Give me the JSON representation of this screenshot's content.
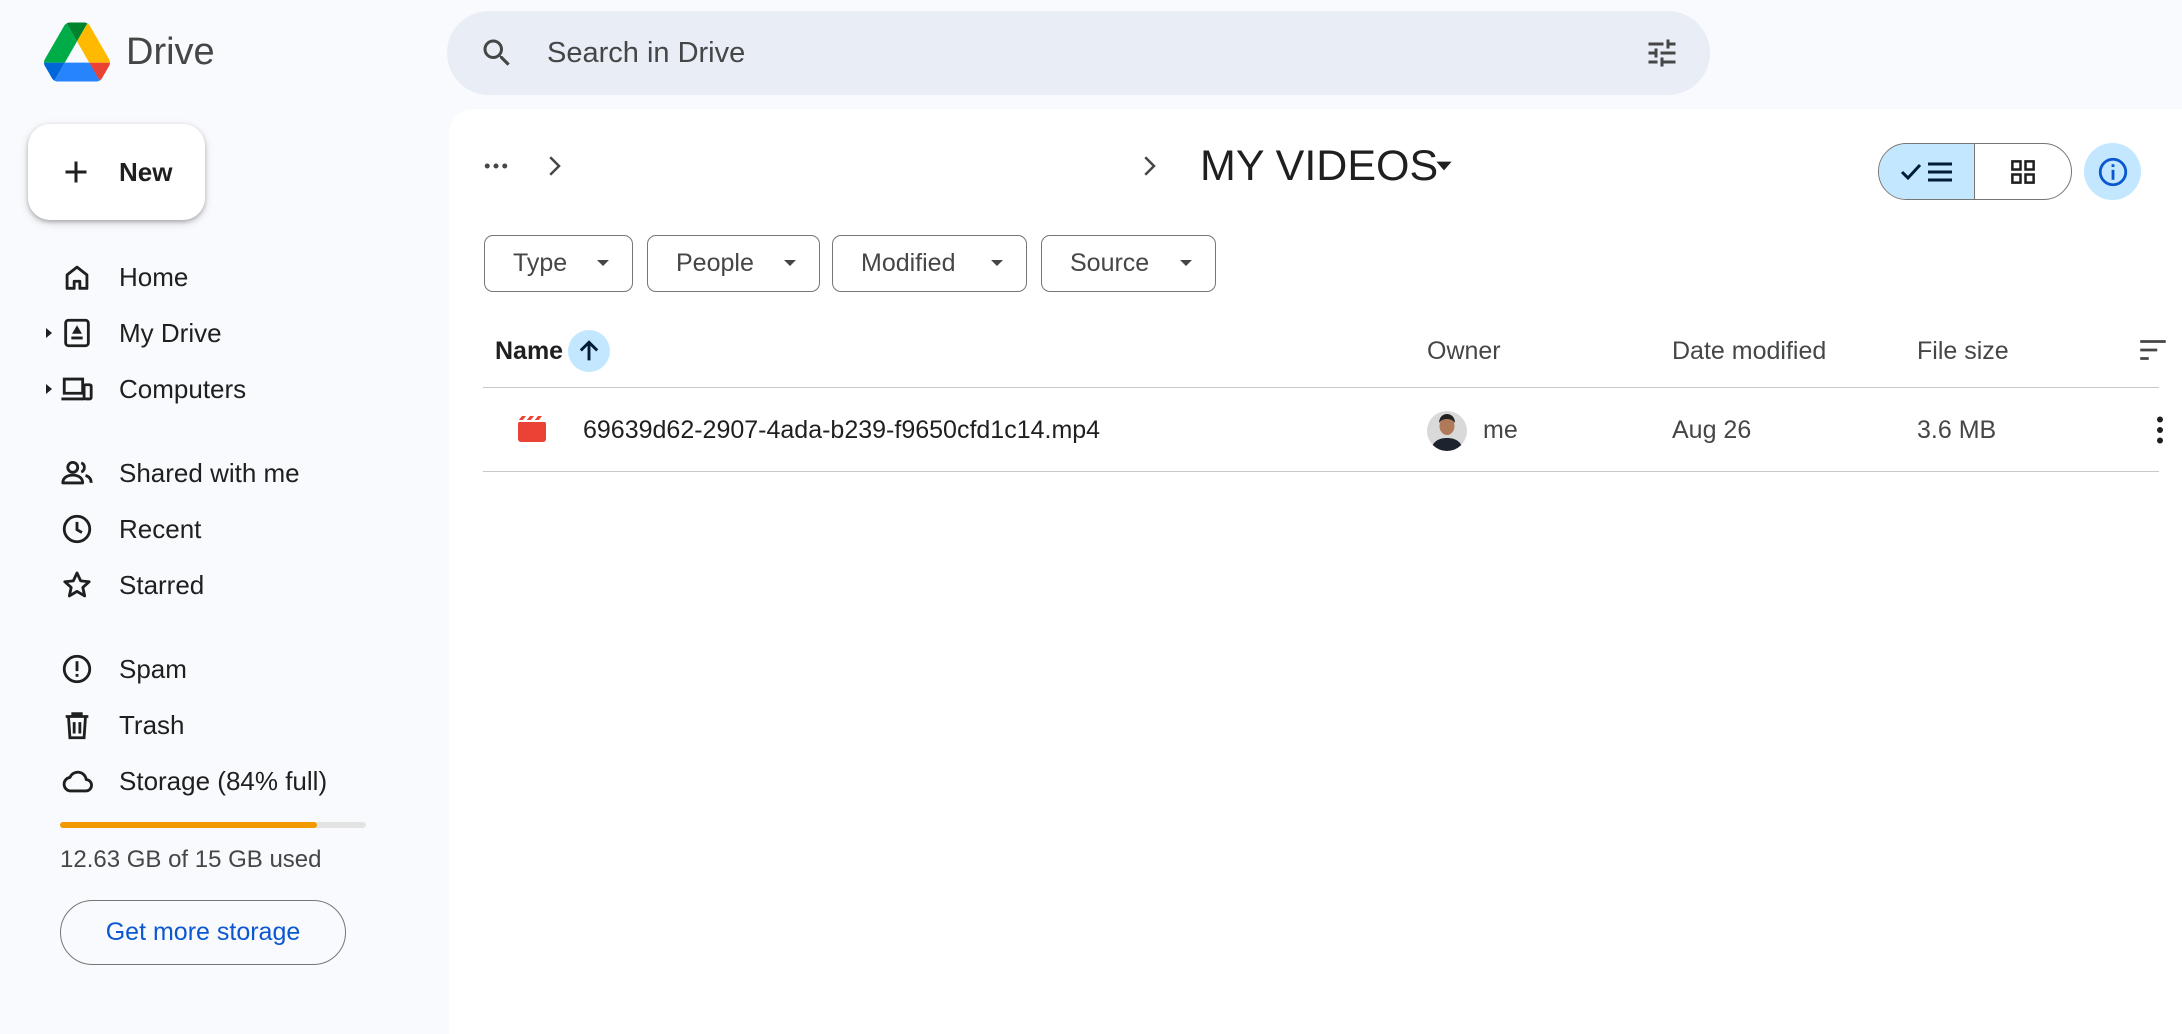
{
  "app": {
    "name": "Drive"
  },
  "search": {
    "placeholder": "Search in Drive"
  },
  "sidebar": {
    "new_label": "New",
    "items": [
      {
        "label": "Home",
        "icon": "home-icon"
      },
      {
        "label": "My Drive",
        "icon": "my-drive-icon",
        "expandable": true
      },
      {
        "label": "Computers",
        "icon": "computers-icon",
        "expandable": true
      },
      {
        "label": "Shared with me",
        "icon": "shared-icon"
      },
      {
        "label": "Recent",
        "icon": "clock-icon"
      },
      {
        "label": "Starred",
        "icon": "star-icon"
      },
      {
        "label": "Spam",
        "icon": "spam-icon"
      },
      {
        "label": "Trash",
        "icon": "trash-icon"
      },
      {
        "label": "Storage (84% full)",
        "icon": "cloud-icon"
      }
    ],
    "storage": {
      "used_fraction": 0.84,
      "text": "12.63 GB of 15 GB used",
      "button": "Get more storage"
    }
  },
  "header": {
    "folder_title": "MY VIDEOS"
  },
  "filters": [
    "Type",
    "People",
    "Modified",
    "Source"
  ],
  "table": {
    "columns": {
      "name": "Name",
      "owner": "Owner",
      "date": "Date modified",
      "size": "File size"
    },
    "rows": [
      {
        "name": "69639d62-2907-4ada-b239-f9650cfd1c14.mp4",
        "owner": "me",
        "date": "Aug 26",
        "size": "3.6 MB",
        "icon": "video-file-icon"
      }
    ]
  },
  "colors": {
    "accent": "#c2e7ff",
    "link": "#0b57d0",
    "storage_bar": "#f29900",
    "video_icon": "#ea4335"
  }
}
